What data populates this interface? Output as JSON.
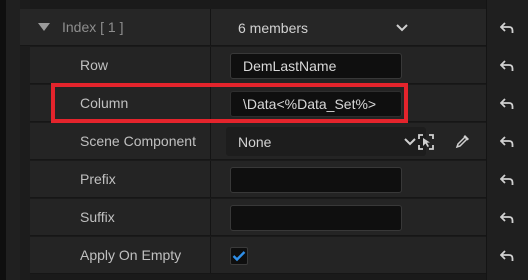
{
  "index_row": {
    "label": "Index [ 1 ]",
    "members": "6 members"
  },
  "rows": {
    "row": {
      "label": "Row",
      "value": "DemLastName"
    },
    "column": {
      "label": "Column",
      "value": "\\Data<%Data_Set%>"
    },
    "scene_component": {
      "label": "Scene Component",
      "value": "None"
    },
    "prefix": {
      "label": "Prefix",
      "value": ""
    },
    "suffix": {
      "label": "Suffix",
      "value": ""
    },
    "apply_on_empty": {
      "label": "Apply On Empty",
      "checked": true
    }
  },
  "colors": {
    "highlight": "#e4242c",
    "checkbox_check": "#2f8fe8"
  },
  "icons": [
    "chevron-down-icon",
    "expand-triangle-icon",
    "reset-arrow-icon",
    "select-actor-icon",
    "eyedropper-icon",
    "checkmark-icon"
  ]
}
